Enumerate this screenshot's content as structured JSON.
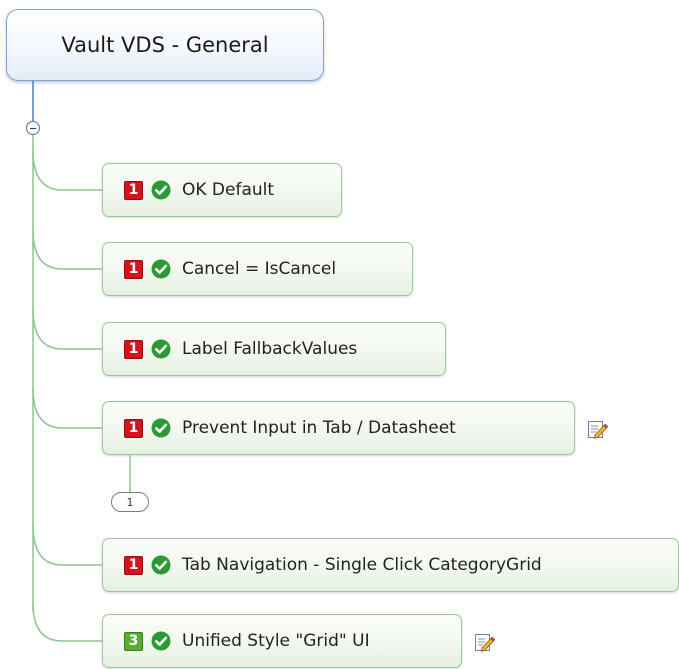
{
  "root": {
    "label": "Vault VDS - General"
  },
  "collapse_toggle": {
    "icon": "minus-circle-icon",
    "state": "expanded"
  },
  "topics": [
    {
      "priority": "1",
      "priority_color": "#d3141f",
      "status_icon": "check-circle-icon",
      "label": "OK Default"
    },
    {
      "priority": "1",
      "priority_color": "#d3141f",
      "status_icon": "check-circle-icon",
      "label": "Cancel = IsCancel"
    },
    {
      "priority": "1",
      "priority_color": "#d3141f",
      "status_icon": "check-circle-icon",
      "label": "Label FallbackValues"
    },
    {
      "priority": "1",
      "priority_color": "#d3141f",
      "status_icon": "check-circle-icon",
      "label": "Prevent Input in Tab / Datasheet",
      "has_note": true,
      "collapsed_child_count": "1"
    },
    {
      "priority": "1",
      "priority_color": "#d3141f",
      "status_icon": "check-circle-icon",
      "label": "Tab Navigation - Single Click CategoryGrid"
    },
    {
      "priority": "3",
      "priority_color": "#5aac35",
      "status_icon": "check-circle-icon",
      "label": "Unified Style \"Grid\" UI",
      "has_note": true
    }
  ],
  "colors": {
    "connector": "#8fc48f",
    "root_border": "#7fa2d4",
    "topic_border": "#9cc79c",
    "check_green": "#2a9a34",
    "priority_red": "#d3141f",
    "priority_green": "#5aac35"
  }
}
